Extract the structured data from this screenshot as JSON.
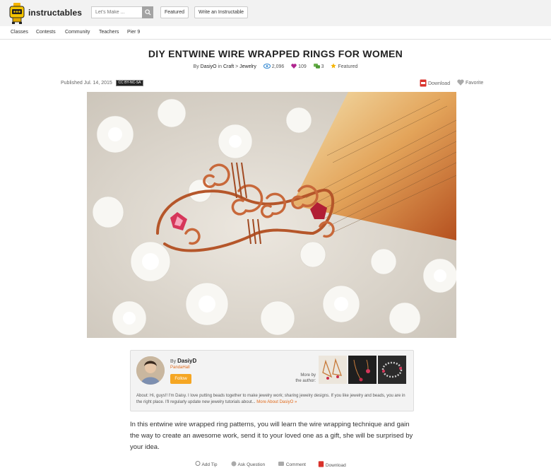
{
  "header": {
    "logo_text": "instructables",
    "search": {
      "placeholder": "Let's Make ..."
    },
    "buttons": [
      {
        "label": "Featured"
      },
      {
        "label": "Write an Instructable"
      }
    ]
  },
  "subnav": [
    {
      "label": "Classes"
    },
    {
      "label": "Contests"
    },
    {
      "label": "Community"
    },
    {
      "label": "Teachers"
    },
    {
      "label": "Pier 9"
    }
  ],
  "article": {
    "title": "DIY ENTWINE WIRE WRAPPED RINGS FOR WOMEN",
    "by_prefix": "By",
    "author": "DasiyO",
    "in_word": "in",
    "category": "Craft",
    "arrow": ">",
    "subcategory": "Jewelry",
    "views": "2,096",
    "favorites": "109",
    "comments": "3",
    "featured": "Featured",
    "published": "Published Jul. 14, 2015",
    "license": "CC BY-NC-SA",
    "download": "Download",
    "favorite": "Favorite"
  },
  "author_card": {
    "by": "By",
    "name": "DasiyD",
    "subtitle": "PandaHall",
    "follow": "Follow",
    "more_by_line1": "More by",
    "more_by_line2": "the author:",
    "about": "About: Hi, guys!! I'm Daisy. I love putting beads together to make jewelry work; sharing jewelry designs. If you like jewelry and beads, you are in the right place. I'll regularly update new jewelry tutorials about...",
    "more_about": "More About DasiyO »"
  },
  "intro": "In this entwine wire wrapped ring patterns, you will learn the wire wrapping technique and gain the way to create an awesome work, send it to your loved one as a gift, she will be surprised by your idea.",
  "actions": [
    {
      "label": "Add Tip"
    },
    {
      "label": "Ask Question"
    },
    {
      "label": "Comment"
    },
    {
      "label": "Download"
    }
  ],
  "colors": {
    "accent_orange": "#f5a623",
    "link_orange": "#e06a1b",
    "views_blue": "#3b8dd3",
    "fav_purple": "#b0258f",
    "comment_green": "#6ab04c",
    "star_yellow": "#f5b400"
  }
}
